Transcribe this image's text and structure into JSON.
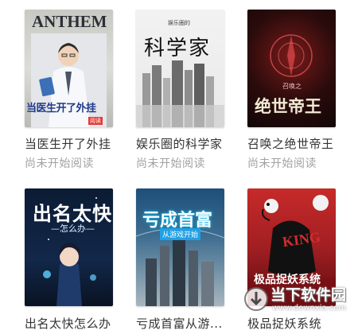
{
  "books": [
    {
      "title": "当医生开了外挂",
      "status": "尚未开始阅读",
      "cover": {
        "brand": "ANTHEM",
        "headline": "当医生开了外挂",
        "badge": "阅读"
      }
    },
    {
      "title": "娱乐圈的科学家",
      "status": "尚未开始阅读",
      "cover": {
        "top": "娱乐圈的",
        "headline": "科学家"
      }
    },
    {
      "title": "召唤之绝世帝王",
      "status": "尚未开始阅读",
      "cover": {
        "top": "召唤之",
        "headline": "绝世帝王"
      }
    },
    {
      "title": "出名太快怎么办",
      "status": "",
      "cover": {
        "headline": "出名太快",
        "sub": "—怎么办—"
      }
    },
    {
      "title": "亏成首富从游...",
      "status": "",
      "cover": {
        "headline": "亏成首富",
        "sub": "从游戏开始"
      }
    },
    {
      "title": "极品捉妖系统",
      "status": "",
      "cover": {
        "top": "KING",
        "headline": "极品捉妖系统"
      }
    }
  ],
  "watermark": {
    "cn": "当下软件园",
    "url": "www.downxia.com"
  }
}
